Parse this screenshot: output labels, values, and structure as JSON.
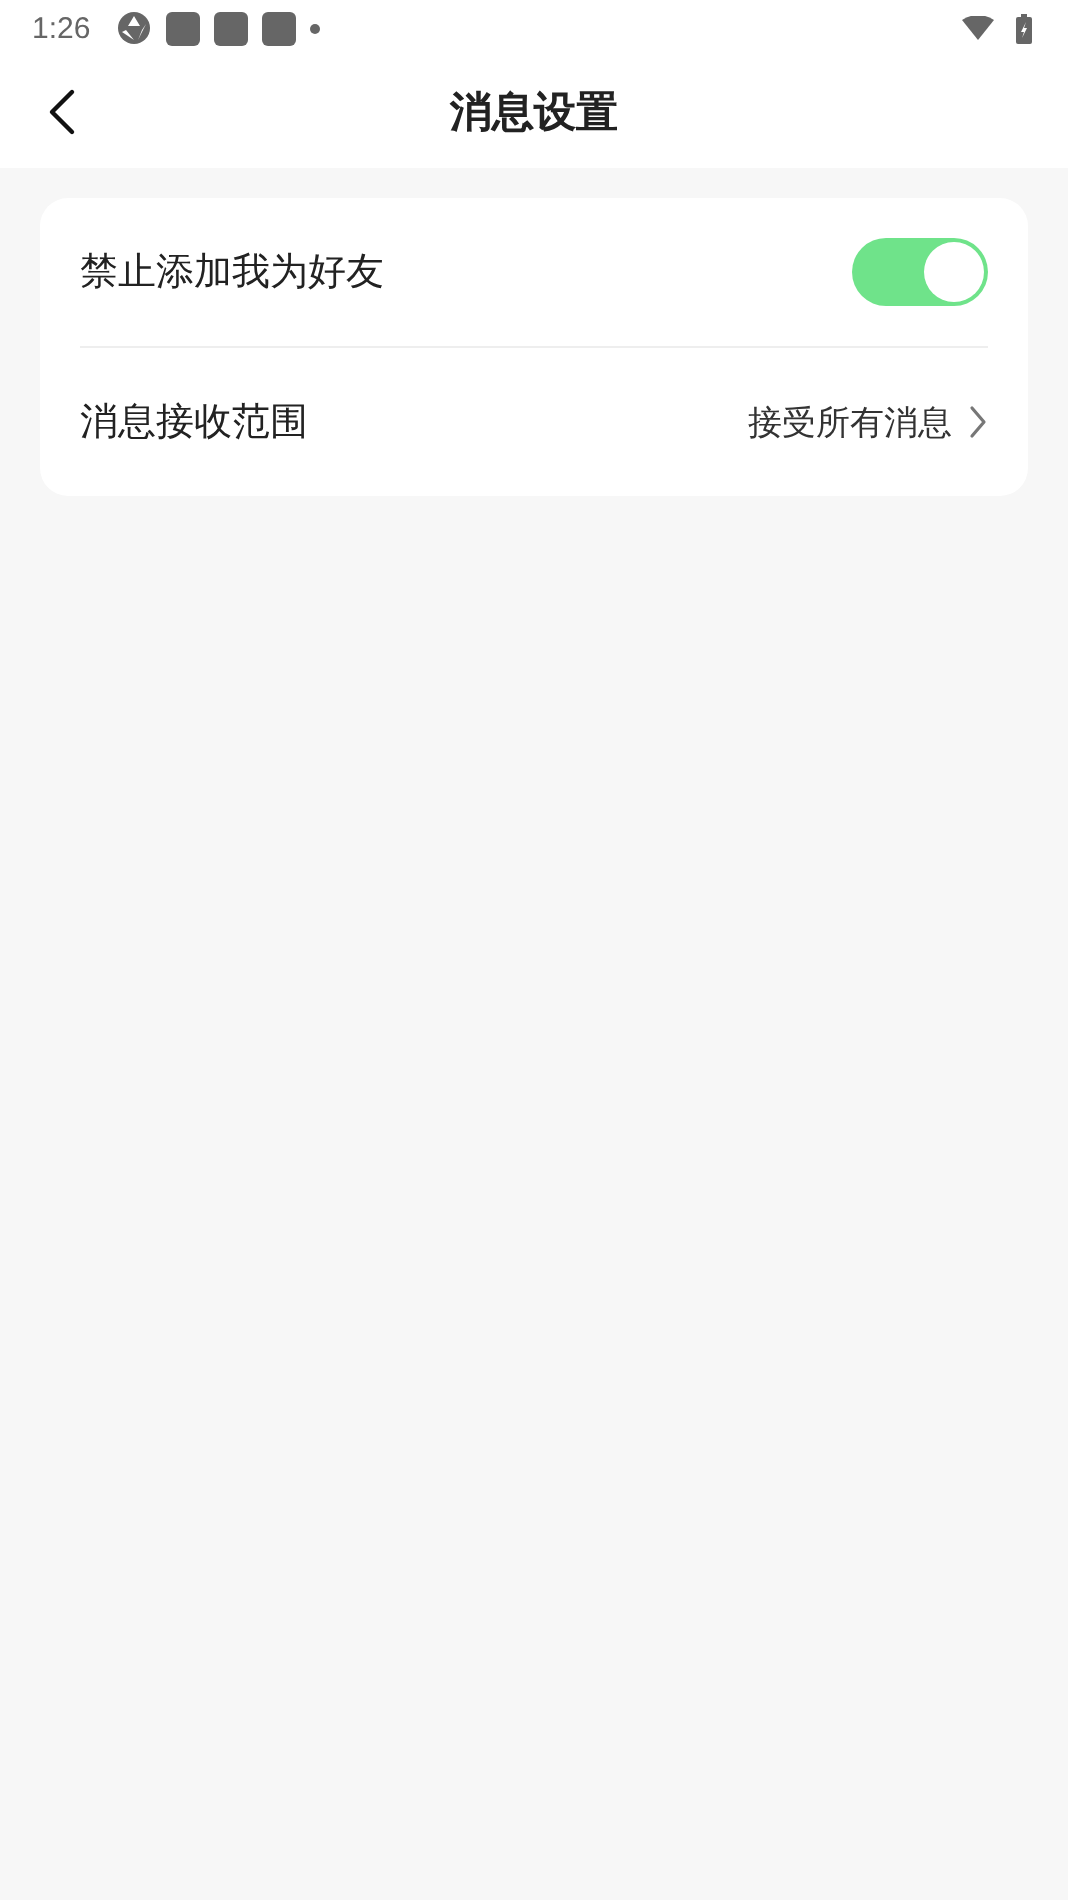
{
  "status_bar": {
    "time": "1:26"
  },
  "header": {
    "title": "消息设置"
  },
  "settings": [
    {
      "kind": "toggle",
      "label": "禁止添加我为好友",
      "on": true
    },
    {
      "kind": "link",
      "label": "消息接收范围",
      "value": "接受所有消息"
    }
  ]
}
